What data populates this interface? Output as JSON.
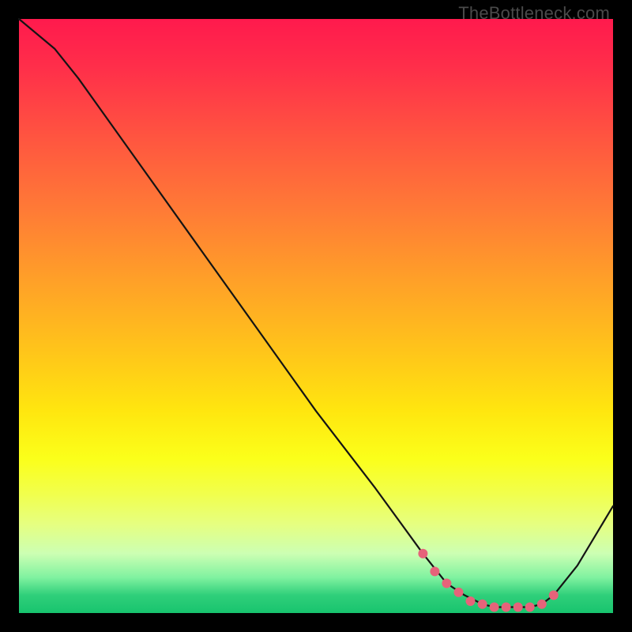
{
  "watermark": "TheBottleneck.com",
  "chart_data": {
    "type": "line",
    "title": "",
    "xlabel": "",
    "ylabel": "",
    "xlim": [
      0,
      100
    ],
    "ylim": [
      0,
      100
    ],
    "series": [
      {
        "name": "bottleneck-curve",
        "x": [
          0,
          6,
          10,
          20,
          30,
          40,
          50,
          60,
          68,
          72,
          75,
          78,
          80,
          82,
          84,
          86,
          88,
          90,
          94,
          100
        ],
        "y": [
          100,
          95,
          90,
          76,
          62,
          48,
          34,
          21,
          10,
          5,
          3,
          1.5,
          1,
          1,
          1,
          1,
          1.5,
          3,
          8,
          18
        ]
      }
    ],
    "markers": {
      "name": "valley-markers",
      "x": [
        68,
        70,
        72,
        74,
        76,
        78,
        80,
        82,
        84,
        86,
        88,
        90
      ],
      "y": [
        10,
        7,
        5,
        3.5,
        2,
        1.5,
        1,
        1,
        1,
        1,
        1.5,
        3
      ]
    },
    "gradient_stops": [
      {
        "pos": 0,
        "color": "#ff1a4d"
      },
      {
        "pos": 50,
        "color": "#ffc51a"
      },
      {
        "pos": 80,
        "color": "#f1ff4d"
      },
      {
        "pos": 100,
        "color": "#18c46e"
      }
    ]
  }
}
